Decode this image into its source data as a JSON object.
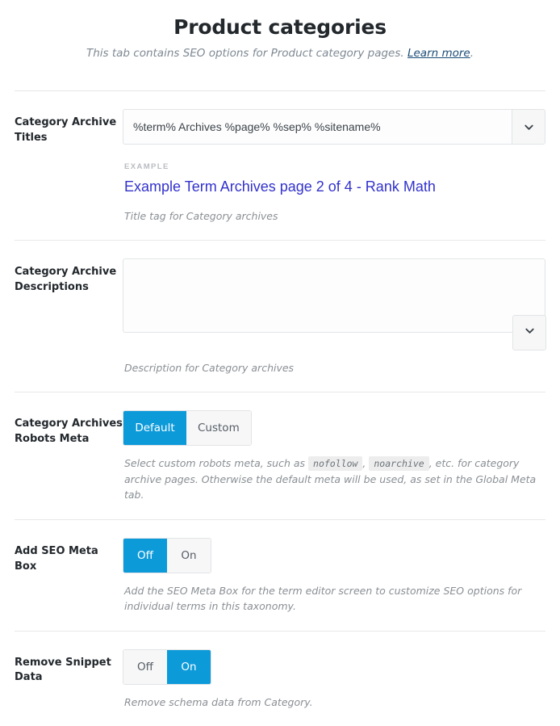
{
  "header": {
    "title": "Product categories",
    "subtitle_before": "This tab contains SEO options for Product category pages. ",
    "link_label": "Learn more",
    "subtitle_after": "."
  },
  "fields": {
    "archive_titles": {
      "label": "Category Archive Titles",
      "value": "%term% Archives %page% %sep% %sitename%",
      "placeholder": "",
      "example_label": "EXAMPLE",
      "example_value": "Example Term Archives page 2 of 4 - Rank Math",
      "description": "Title tag for Category archives",
      "chevron_icon": "chevron-down-icon"
    },
    "archive_descriptions": {
      "label": "Category Archive Descriptions",
      "value": "",
      "placeholder": "",
      "description": "Description for Category archives",
      "chevron_icon": "chevron-down-icon"
    },
    "robots_meta": {
      "label": "Category Archives Robots Meta",
      "options": [
        "Default",
        "Custom"
      ],
      "selected": "Default",
      "desc_part1": "Select custom robots meta, such as ",
      "code1": "nofollow",
      "desc_part2": ", ",
      "code2": "noarchive",
      "desc_part3": ", etc. for category archive pages. Otherwise the default meta will be used, as set in the Global Meta tab."
    },
    "seo_meta_box": {
      "label": "Add SEO Meta Box",
      "options": [
        "Off",
        "On"
      ],
      "selected": "Off",
      "description": "Add the SEO Meta Box for the term editor screen to customize SEO options for individual terms in this taxonomy."
    },
    "remove_snippet_data": {
      "label": "Remove Snippet Data",
      "options": [
        "Off",
        "On"
      ],
      "selected": "On",
      "description": "Remove schema data from Category."
    }
  },
  "colors": {
    "accent": "#0d9ad9",
    "example_text": "#3232cd",
    "link": "#1c4c77",
    "label": "#23282d",
    "muted": "#8a8f94"
  }
}
